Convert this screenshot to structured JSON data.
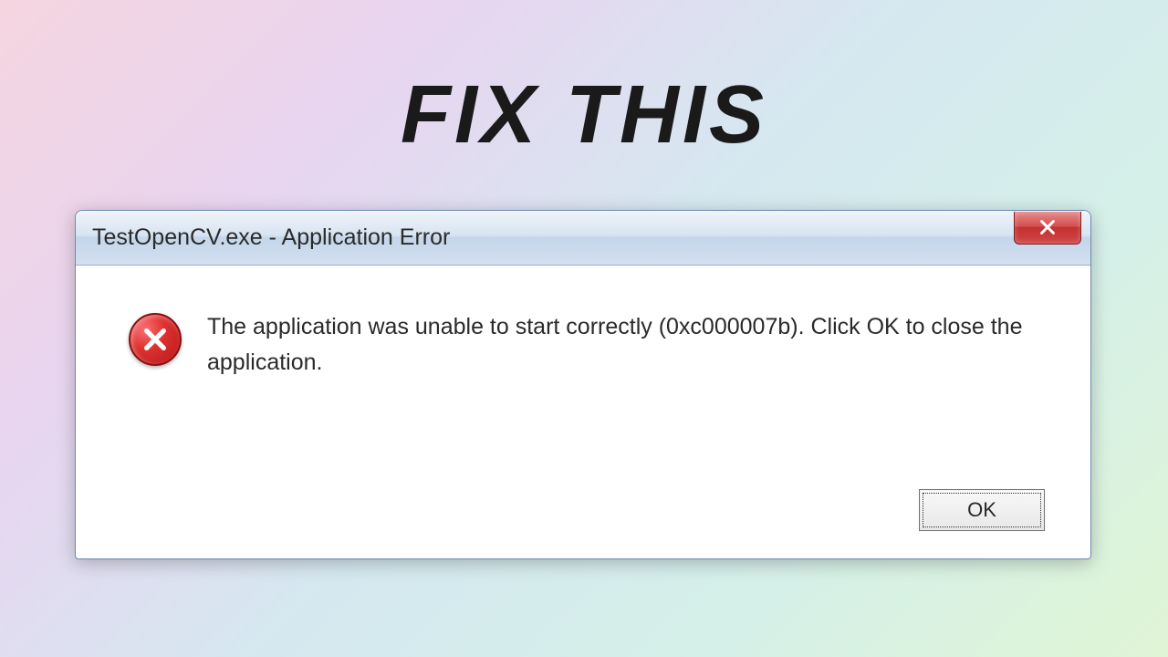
{
  "headline": "FIX  THIS",
  "dialog": {
    "title": "TestOpenCV.exe - Application Error",
    "message": "The application was unable to start correctly (0xc000007b). Click OK to close the application.",
    "ok_label": "OK"
  }
}
